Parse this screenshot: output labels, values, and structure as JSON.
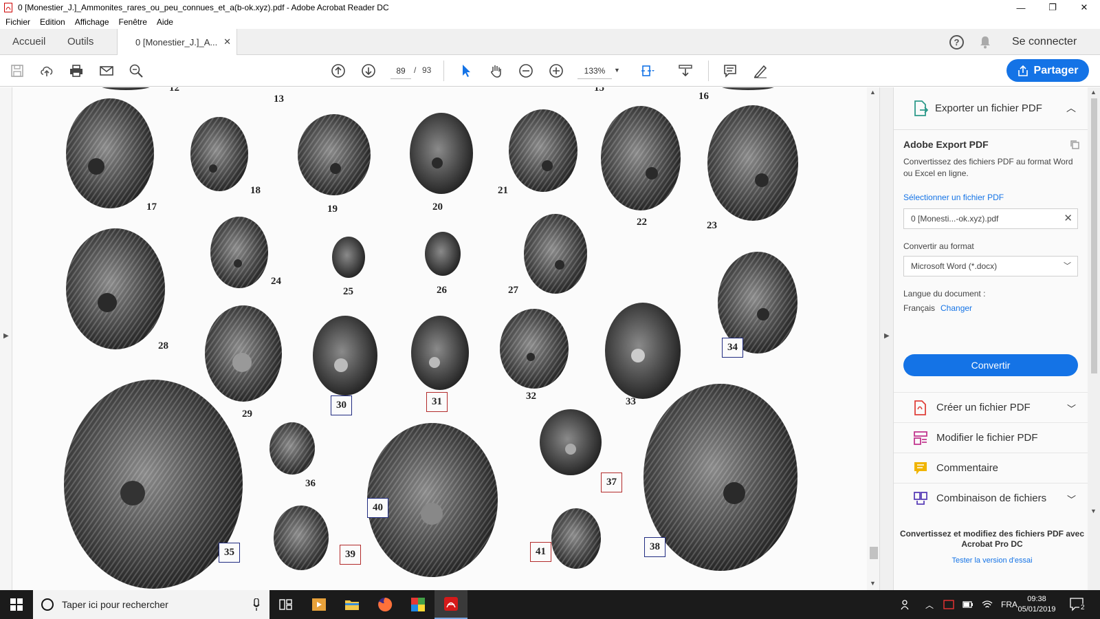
{
  "window": {
    "title": "0 [Monestier_J.]_Ammonites_rares_ou_peu_connues_et_a(b-ok.xyz).pdf - Adobe Acrobat Reader DC",
    "minimize": "—",
    "maximize": "❐",
    "close": "✕"
  },
  "menu": {
    "items": [
      "Fichier",
      "Edition",
      "Affichage",
      "Fenêtre",
      "Aide"
    ]
  },
  "tabs": {
    "home": "Accueil",
    "tools": "Outils",
    "document": "0  [Monestier_J.]_A...",
    "close": "✕",
    "help": "?",
    "signin": "Se connecter"
  },
  "toolbar": {
    "page_current": "89",
    "page_separator": "/",
    "page_total": "93",
    "zoom": "133%",
    "share_label": "Partager"
  },
  "plate": {
    "numbers": [
      {
        "n": "12",
        "boxed": false,
        "color": null
      },
      {
        "n": "13",
        "boxed": false,
        "color": null
      },
      {
        "n": "15",
        "boxed": false,
        "color": null
      },
      {
        "n": "16",
        "boxed": false,
        "color": null
      },
      {
        "n": "17",
        "boxed": false,
        "color": null
      },
      {
        "n": "18",
        "boxed": false,
        "color": null
      },
      {
        "n": "19",
        "boxed": false,
        "color": null
      },
      {
        "n": "20",
        "boxed": false,
        "color": null
      },
      {
        "n": "21",
        "boxed": false,
        "color": null
      },
      {
        "n": "22",
        "boxed": false,
        "color": null
      },
      {
        "n": "23",
        "boxed": false,
        "color": null
      },
      {
        "n": "24",
        "boxed": false,
        "color": null
      },
      {
        "n": "25",
        "boxed": false,
        "color": null
      },
      {
        "n": "26",
        "boxed": false,
        "color": null
      },
      {
        "n": "27",
        "boxed": false,
        "color": null
      },
      {
        "n": "28",
        "boxed": false,
        "color": null
      },
      {
        "n": "29",
        "boxed": false,
        "color": null
      },
      {
        "n": "30",
        "boxed": true,
        "color": "#1f2a80"
      },
      {
        "n": "31",
        "boxed": true,
        "color": "#b22a2a"
      },
      {
        "n": "32",
        "boxed": false,
        "color": null
      },
      {
        "n": "33",
        "boxed": false,
        "color": null
      },
      {
        "n": "34",
        "boxed": true,
        "color": "#1f2a80"
      },
      {
        "n": "35",
        "boxed": true,
        "color": "#1f2a80"
      },
      {
        "n": "36",
        "boxed": false,
        "color": null
      },
      {
        "n": "37",
        "boxed": true,
        "color": "#b22a2a"
      },
      {
        "n": "38",
        "boxed": true,
        "color": "#1f2a80"
      },
      {
        "n": "39",
        "boxed": true,
        "color": "#b22a2a"
      },
      {
        "n": "40",
        "boxed": true,
        "color": "#1f2a80"
      },
      {
        "n": "41",
        "boxed": true,
        "color": "#b22a2a"
      }
    ]
  },
  "export_panel": {
    "header": "Exporter un fichier PDF",
    "title": "Adobe Export PDF",
    "description": "Convertissez des fichiers PDF au format Word ou Excel en ligne.",
    "select_link": "Sélectionner un fichier PDF",
    "file_name": "0 [Monesti...-ok.xyz).pdf",
    "convert_label": "Convertir au format",
    "format_value": "Microsoft Word (*.docx)",
    "language_label": "Langue du document :",
    "language_value": "Français",
    "language_change": "Changer",
    "convert_button": "Convertir"
  },
  "tools_list": [
    {
      "label": "Créer un fichier PDF",
      "has_chevron": true,
      "icon": "create-pdf-icon",
      "color": "#e0403a"
    },
    {
      "label": "Modifier le fichier PDF",
      "has_chevron": false,
      "icon": "edit-pdf-icon",
      "color": "#c2378f"
    },
    {
      "label": "Commentaire",
      "has_chevron": false,
      "icon": "comment-icon",
      "color": "#f0b400"
    },
    {
      "label": "Combinaison de fichiers",
      "has_chevron": true,
      "icon": "combine-files-icon",
      "color": "#5a3fb8"
    }
  ],
  "promo": {
    "title": "Convertissez et modifiez des fichiers PDF avec Acrobat Pro DC",
    "link": "Tester la version d'essai"
  },
  "taskbar": {
    "search_placeholder": "Taper ici pour rechercher",
    "language": "FRA",
    "time": "09:38",
    "date": "05/01/2019",
    "notification_count": "2"
  },
  "colors": {
    "accent": "#1473e6",
    "taskbar": "#1b1b1b"
  }
}
